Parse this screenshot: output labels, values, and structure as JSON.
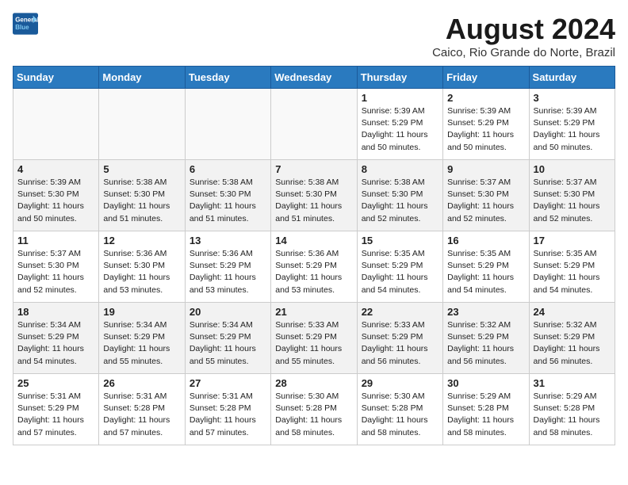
{
  "header": {
    "logo_line1": "General",
    "logo_line2": "Blue",
    "month_year": "August 2024",
    "location": "Caico, Rio Grande do Norte, Brazil"
  },
  "days_of_week": [
    "Sunday",
    "Monday",
    "Tuesday",
    "Wednesday",
    "Thursday",
    "Friday",
    "Saturday"
  ],
  "weeks": [
    [
      {
        "num": "",
        "info": ""
      },
      {
        "num": "",
        "info": ""
      },
      {
        "num": "",
        "info": ""
      },
      {
        "num": "",
        "info": ""
      },
      {
        "num": "1",
        "info": "Sunrise: 5:39 AM\nSunset: 5:29 PM\nDaylight: 11 hours\nand 50 minutes."
      },
      {
        "num": "2",
        "info": "Sunrise: 5:39 AM\nSunset: 5:29 PM\nDaylight: 11 hours\nand 50 minutes."
      },
      {
        "num": "3",
        "info": "Sunrise: 5:39 AM\nSunset: 5:29 PM\nDaylight: 11 hours\nand 50 minutes."
      }
    ],
    [
      {
        "num": "4",
        "info": "Sunrise: 5:39 AM\nSunset: 5:30 PM\nDaylight: 11 hours\nand 50 minutes."
      },
      {
        "num": "5",
        "info": "Sunrise: 5:38 AM\nSunset: 5:30 PM\nDaylight: 11 hours\nand 51 minutes."
      },
      {
        "num": "6",
        "info": "Sunrise: 5:38 AM\nSunset: 5:30 PM\nDaylight: 11 hours\nand 51 minutes."
      },
      {
        "num": "7",
        "info": "Sunrise: 5:38 AM\nSunset: 5:30 PM\nDaylight: 11 hours\nand 51 minutes."
      },
      {
        "num": "8",
        "info": "Sunrise: 5:38 AM\nSunset: 5:30 PM\nDaylight: 11 hours\nand 52 minutes."
      },
      {
        "num": "9",
        "info": "Sunrise: 5:37 AM\nSunset: 5:30 PM\nDaylight: 11 hours\nand 52 minutes."
      },
      {
        "num": "10",
        "info": "Sunrise: 5:37 AM\nSunset: 5:30 PM\nDaylight: 11 hours\nand 52 minutes."
      }
    ],
    [
      {
        "num": "11",
        "info": "Sunrise: 5:37 AM\nSunset: 5:30 PM\nDaylight: 11 hours\nand 52 minutes."
      },
      {
        "num": "12",
        "info": "Sunrise: 5:36 AM\nSunset: 5:30 PM\nDaylight: 11 hours\nand 53 minutes."
      },
      {
        "num": "13",
        "info": "Sunrise: 5:36 AM\nSunset: 5:29 PM\nDaylight: 11 hours\nand 53 minutes."
      },
      {
        "num": "14",
        "info": "Sunrise: 5:36 AM\nSunset: 5:29 PM\nDaylight: 11 hours\nand 53 minutes."
      },
      {
        "num": "15",
        "info": "Sunrise: 5:35 AM\nSunset: 5:29 PM\nDaylight: 11 hours\nand 54 minutes."
      },
      {
        "num": "16",
        "info": "Sunrise: 5:35 AM\nSunset: 5:29 PM\nDaylight: 11 hours\nand 54 minutes."
      },
      {
        "num": "17",
        "info": "Sunrise: 5:35 AM\nSunset: 5:29 PM\nDaylight: 11 hours\nand 54 minutes."
      }
    ],
    [
      {
        "num": "18",
        "info": "Sunrise: 5:34 AM\nSunset: 5:29 PM\nDaylight: 11 hours\nand 54 minutes."
      },
      {
        "num": "19",
        "info": "Sunrise: 5:34 AM\nSunset: 5:29 PM\nDaylight: 11 hours\nand 55 minutes."
      },
      {
        "num": "20",
        "info": "Sunrise: 5:34 AM\nSunset: 5:29 PM\nDaylight: 11 hours\nand 55 minutes."
      },
      {
        "num": "21",
        "info": "Sunrise: 5:33 AM\nSunset: 5:29 PM\nDaylight: 11 hours\nand 55 minutes."
      },
      {
        "num": "22",
        "info": "Sunrise: 5:33 AM\nSunset: 5:29 PM\nDaylight: 11 hours\nand 56 minutes."
      },
      {
        "num": "23",
        "info": "Sunrise: 5:32 AM\nSunset: 5:29 PM\nDaylight: 11 hours\nand 56 minutes."
      },
      {
        "num": "24",
        "info": "Sunrise: 5:32 AM\nSunset: 5:29 PM\nDaylight: 11 hours\nand 56 minutes."
      }
    ],
    [
      {
        "num": "25",
        "info": "Sunrise: 5:31 AM\nSunset: 5:29 PM\nDaylight: 11 hours\nand 57 minutes."
      },
      {
        "num": "26",
        "info": "Sunrise: 5:31 AM\nSunset: 5:28 PM\nDaylight: 11 hours\nand 57 minutes."
      },
      {
        "num": "27",
        "info": "Sunrise: 5:31 AM\nSunset: 5:28 PM\nDaylight: 11 hours\nand 57 minutes."
      },
      {
        "num": "28",
        "info": "Sunrise: 5:30 AM\nSunset: 5:28 PM\nDaylight: 11 hours\nand 58 minutes."
      },
      {
        "num": "29",
        "info": "Sunrise: 5:30 AM\nSunset: 5:28 PM\nDaylight: 11 hours\nand 58 minutes."
      },
      {
        "num": "30",
        "info": "Sunrise: 5:29 AM\nSunset: 5:28 PM\nDaylight: 11 hours\nand 58 minutes."
      },
      {
        "num": "31",
        "info": "Sunrise: 5:29 AM\nSunset: 5:28 PM\nDaylight: 11 hours\nand 58 minutes."
      }
    ]
  ]
}
